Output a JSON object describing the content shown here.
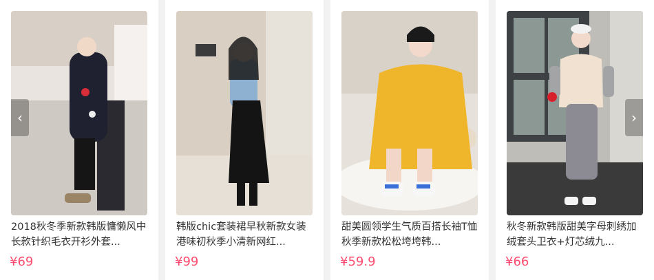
{
  "products": [
    {
      "title": "2018秋冬季新款韩版慵懒风中长款针织毛衣开衫外套...",
      "price": "¥69"
    },
    {
      "title": "韩版chic套装裙早秋新款女装港味初秋季小清新网红...",
      "price": "¥99"
    },
    {
      "title": "甜美圆领学生气质百搭长袖T恤秋季新款松松垮垮韩...",
      "price": "¥59.9"
    },
    {
      "title": "秋冬新款韩版甜美字母刺绣加绒套头卫衣+灯芯绒九...",
      "price": "¥66"
    }
  ],
  "nav": {
    "prev_icon": "‹",
    "next_icon": "›"
  },
  "colors": {
    "price": "#ff4b6e",
    "background": "#f2f2f2"
  }
}
